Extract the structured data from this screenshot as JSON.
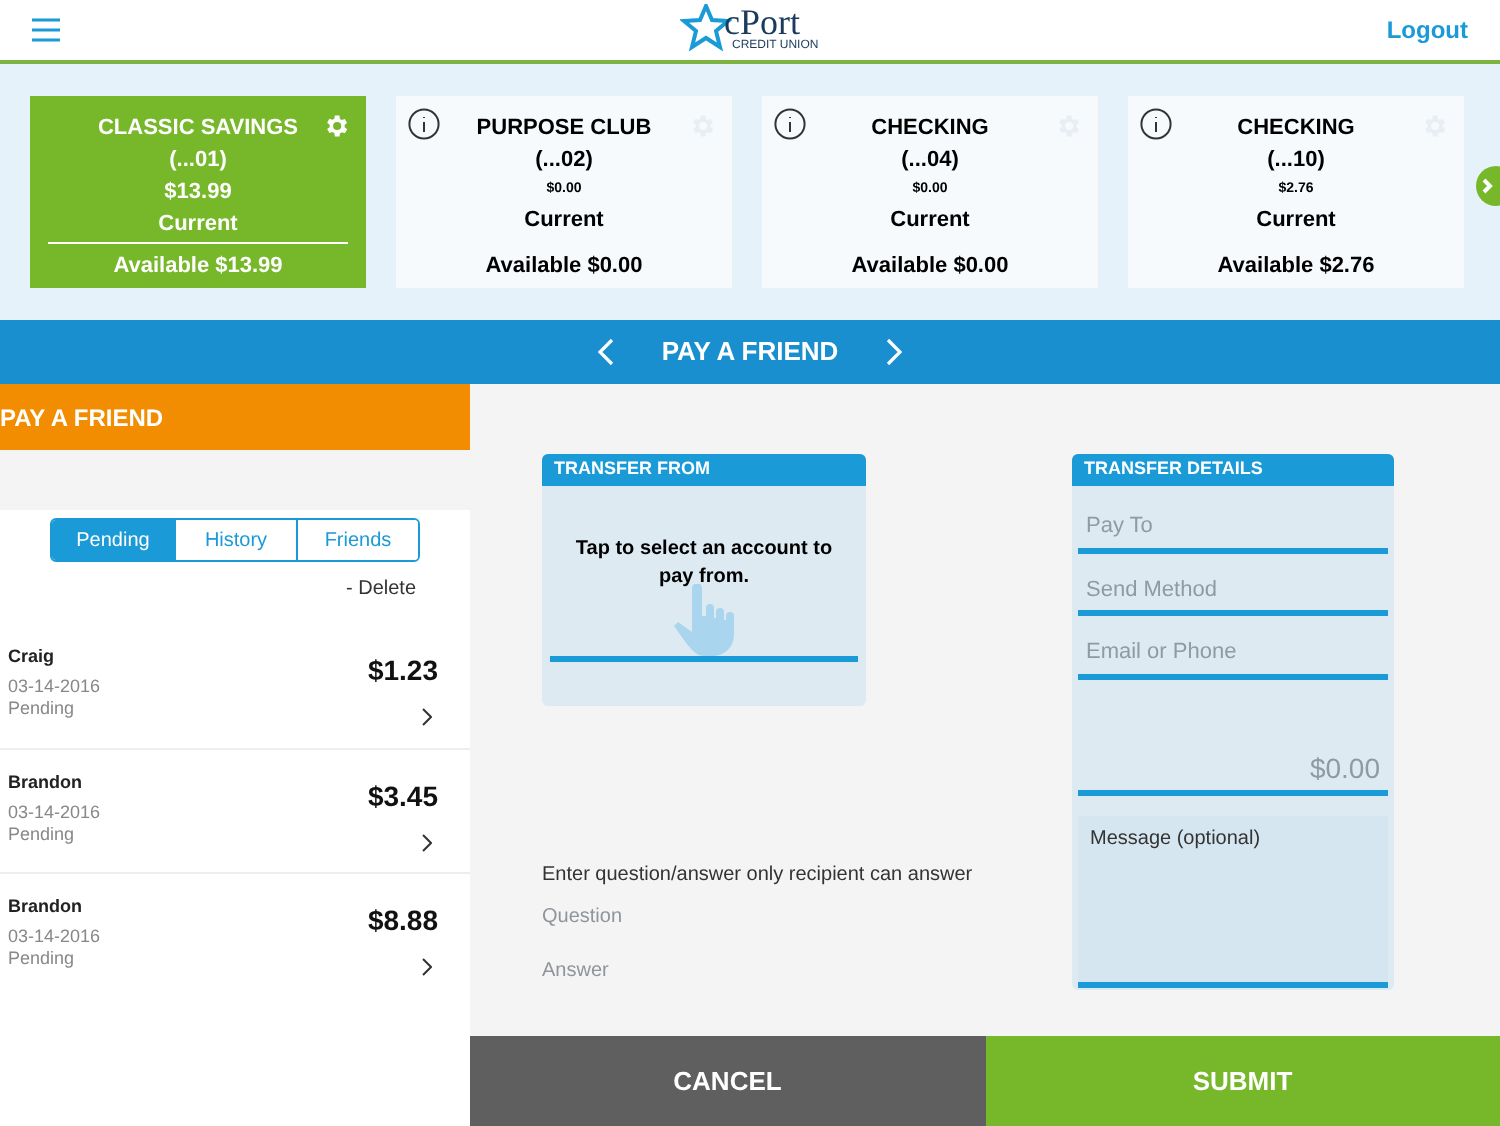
{
  "header": {
    "logo_text": "cPort",
    "logo_subtext": "CREDIT UNION",
    "logout": "Logout"
  },
  "accounts": [
    {
      "name": "CLASSIC SAVINGS",
      "number": "(...01)",
      "balance": "$13.99",
      "status": "Current",
      "available": "Available $13.99",
      "selected": true
    },
    {
      "name": "PURPOSE CLUB",
      "number": "(...02)",
      "balance": "$0.00",
      "status": "Current",
      "available": "Available $0.00",
      "selected": false
    },
    {
      "name": "CHECKING",
      "number": "(...04)",
      "balance": "$0.00",
      "status": "Current",
      "available": "Available $0.00",
      "selected": false
    },
    {
      "name": "CHECKING",
      "number": "(...10)",
      "balance": "$2.76",
      "status": "Current",
      "available": "Available $2.76",
      "selected": false
    }
  ],
  "nav": {
    "title": "PAY A FRIEND"
  },
  "sidebar": {
    "title": "PAY A FRIEND",
    "tabs": [
      {
        "label": "Pending",
        "selected": true
      },
      {
        "label": "History",
        "selected": false
      },
      {
        "label": "Friends",
        "selected": false
      }
    ],
    "delete": "- Delete",
    "payments": [
      {
        "name": "Craig",
        "date": "03-14-2016",
        "status": "Pending",
        "amount": "$1.23"
      },
      {
        "name": "Brandon",
        "date": "03-14-2016",
        "status": "Pending",
        "amount": "$3.45"
      },
      {
        "name": "Brandon",
        "date": "03-14-2016",
        "status": "Pending",
        "amount": "$8.88"
      }
    ]
  },
  "transfer_from": {
    "title": "TRANSFER FROM",
    "prompt": "Tap to select an account to pay from."
  },
  "security": {
    "label": "Enter question/answer only recipient can answer",
    "question_placeholder": "Question",
    "answer_placeholder": "Answer"
  },
  "transfer_details": {
    "title": "TRANSFER DETAILS",
    "pay_to_placeholder": "Pay To",
    "send_method_placeholder": "Send Method",
    "contact_placeholder": "Email or Phone",
    "amount_placeholder": "$0.00",
    "message_placeholder": "Message (optional)"
  },
  "buttons": {
    "cancel": "CANCEL",
    "submit": "SUBMIT"
  }
}
